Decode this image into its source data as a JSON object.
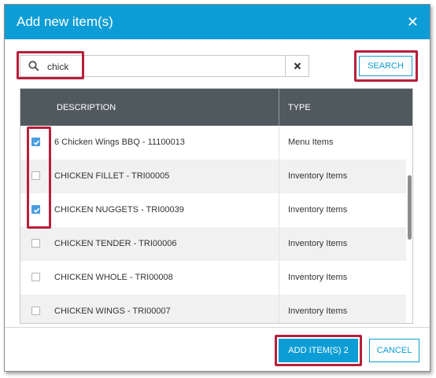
{
  "colors": {
    "accent": "#0d9dd6",
    "header_bg": "#0d9dd6",
    "table_header_bg": "#505a5e",
    "highlight": "#b81f3a",
    "checkbox_checked": "#4b9de0"
  },
  "dialog": {
    "title": "Add new item(s)",
    "close_icon": "close-icon"
  },
  "search": {
    "value": "chick",
    "icon": "search-icon",
    "clear_icon": "clear-icon",
    "button_label": "SEARCH"
  },
  "table": {
    "columns": [
      "DESCRIPTION",
      "TYPE"
    ],
    "rows": [
      {
        "checked": true,
        "description": "6 Chicken Wings BBQ - 11100013",
        "type": "Menu Items"
      },
      {
        "checked": false,
        "description": "CHICKEN FILLET - TRI00005",
        "type": "Inventory Items"
      },
      {
        "checked": true,
        "description": "CHICKEN NUGGETS - TRI00039",
        "type": "Inventory Items"
      },
      {
        "checked": false,
        "description": "CHICKEN TENDER - TRI00006",
        "type": "Inventory Items"
      },
      {
        "checked": false,
        "description": "CHICKEN WHOLE - TRI00008",
        "type": "Inventory Items"
      },
      {
        "checked": false,
        "description": "CHICKEN WINGS - TRI00007",
        "type": "Inventory Items"
      }
    ]
  },
  "footer": {
    "add_label": "ADD ITEM(S) 2",
    "cancel_label": "CANCEL"
  }
}
